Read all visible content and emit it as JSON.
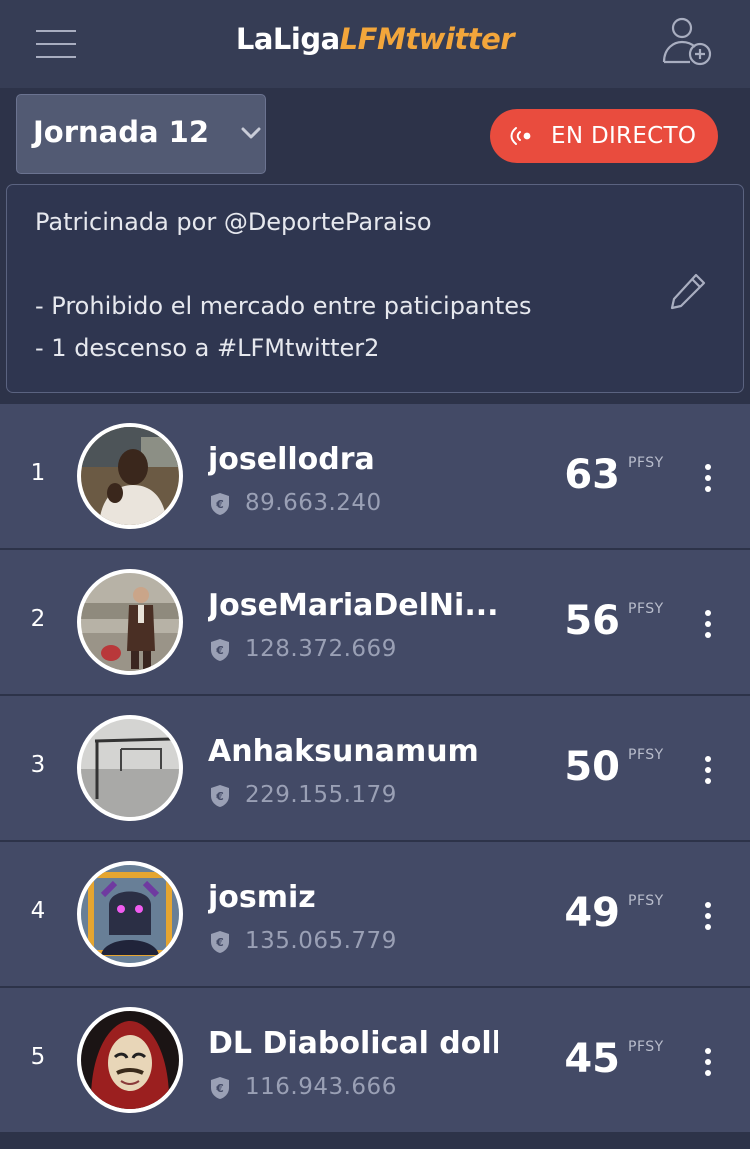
{
  "header": {
    "title_part1": "LaLiga",
    "title_part2": "LFMtwitter",
    "menu_icon": "hamburger-menu-icon",
    "add_user_icon": "add-user-icon"
  },
  "round_selector": {
    "label": "Jornada 12",
    "icon": "chevron-down-icon"
  },
  "live_button": {
    "label": "EN DIRECTO",
    "icon": "live-broadcast-icon",
    "color": "#e94c3e"
  },
  "description": {
    "line1": "Patricinada por @DeporteParaiso",
    "line2": "- Prohibido el mercado entre paticipantes",
    "line3": "- 1 descenso a #LFMtwitter2",
    "edit_icon": "pencil-icon"
  },
  "colors": {
    "background": "#2d3349",
    "header": "#363d55",
    "row": "#434a66",
    "brand_accent": "#f3a63b"
  },
  "ranking": [
    {
      "position": "1",
      "name": "josellodra",
      "team_value": "89.663.240",
      "points": "63",
      "unit": "PFSY"
    },
    {
      "position": "2",
      "name": "JoseMariaDelNi...",
      "team_value": "128.372.669",
      "points": "56",
      "unit": "PFSY"
    },
    {
      "position": "3",
      "name": "Anhaksunamum",
      "team_value": "229.155.179",
      "points": "50",
      "unit": "PFSY"
    },
    {
      "position": "4",
      "name": "josmiz",
      "team_value": "135.065.779",
      "points": "49",
      "unit": "PFSY"
    },
    {
      "position": "5",
      "name": "DL Diabolical doll",
      "team_value": "116.943.666",
      "points": "45",
      "unit": "PFSY"
    }
  ]
}
